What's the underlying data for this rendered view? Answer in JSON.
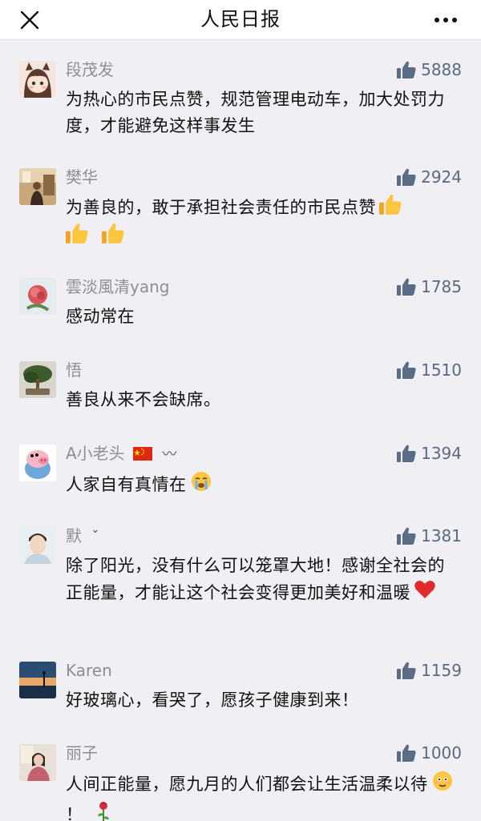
{
  "header": {
    "title": "人民日报"
  },
  "comments": [
    {
      "name": "段茂发",
      "likes": "5888",
      "text": "为热心的市民点赞，规范管理电动车，加大处罚力度，才能避免这样事发生"
    },
    {
      "name": "樊华",
      "likes": "2924",
      "text": "为善良的，敢于承担社会责任的市民点赞"
    },
    {
      "name": "雲淡風清yang",
      "likes": "1785",
      "text": "感动常在"
    },
    {
      "name": "悟",
      "likes": "1510",
      "text": "善良从来不会缺席。"
    },
    {
      "name": "A小老头",
      "name_extra": "〰",
      "likes": "1394",
      "text": "人家自有真情在"
    },
    {
      "name": "默",
      "name_extra": "ˇ",
      "likes": "1381",
      "text": "除了阳光，没有什么可以笼罩大地！感谢全社会的正能量，才能让这个社会变得更加美好和温暖"
    },
    {
      "name": "Karen",
      "likes": "1159",
      "text": "好玻璃心，看哭了，愿孩子健康到来！"
    },
    {
      "name": "丽子",
      "likes": "1000",
      "text": "人间正能量，愿九月的人们都会让生活温柔以待",
      "text_tail": "！"
    }
  ],
  "colors": {
    "header_bg": "#ffffff",
    "page_bg": "#efeff4",
    "name": "#8e8e93",
    "like_count": "#5a6a80",
    "like_icon": "#5b6c87"
  },
  "icons": {
    "close": "close-icon",
    "more": "more-icon",
    "like": "thumbs-up-icon"
  }
}
